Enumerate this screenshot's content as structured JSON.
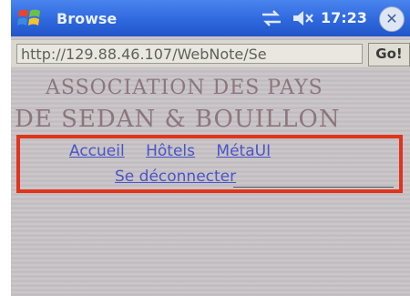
{
  "titlebar": {
    "app_title": "Browse",
    "time": "17:23",
    "close_label": "✕",
    "icons": [
      "windows-start-icon",
      "connectivity-icon",
      "volume-muted-icon",
      "close-icon"
    ]
  },
  "addressbar": {
    "url": "http://129.88.46.107/WebNote/Se",
    "go_label": "Go!"
  },
  "page": {
    "heading_line1": "ASSOCIATION DES PAYS",
    "heading_line2": "DE SEDAN & BOUILLON",
    "nav": {
      "accueil": "Accueil",
      "hotels": "Hôtels",
      "metaui": "MétaUI",
      "logout": "Se déconnecter"
    }
  },
  "colors": {
    "titlebar": "#2f68dd",
    "link": "#4a54c8",
    "highlight": "#e0341c",
    "heading": "#8c767c"
  }
}
